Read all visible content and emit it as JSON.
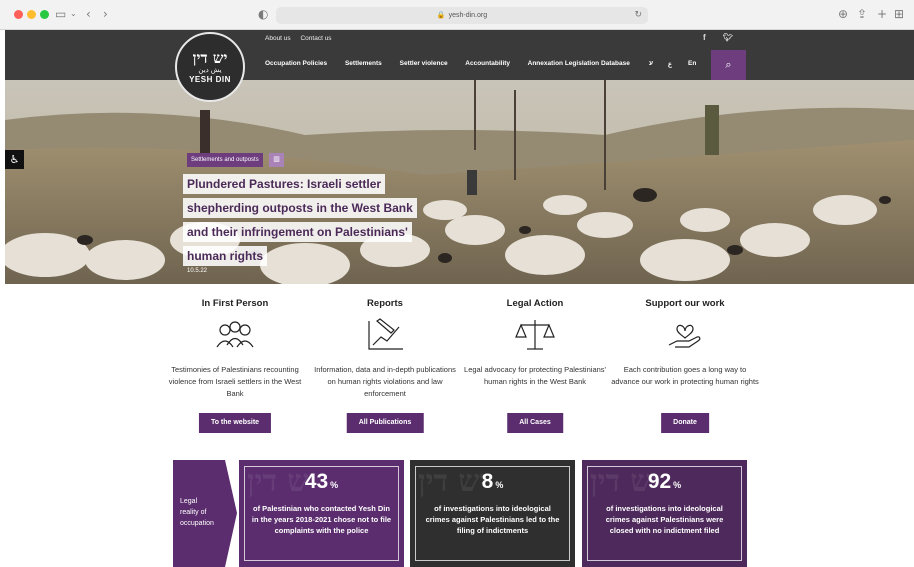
{
  "browser": {
    "url": "yesh-din.org",
    "lock_icon": "lock-icon"
  },
  "site": {
    "logo": {
      "hebrew": "יש דין",
      "arabic": "يش دين",
      "english": "YESH DIN"
    },
    "util_links": [
      "About us",
      "Contact us"
    ],
    "social": [
      "f",
      "t"
    ],
    "nav": [
      "Occupation Policies",
      "Settlements",
      "Settler violence",
      "Accountability",
      "Annexation Legislation Database"
    ],
    "languages": [
      "ע",
      "ع",
      "En"
    ],
    "accent": "#6d3d7e"
  },
  "hero": {
    "tag": "Settlements and outposts",
    "title_lines": [
      "Plundered Pastures: Israeli settler",
      "shepherding outposts in the West Bank",
      "and their infringement on Palestinians'",
      "human rights"
    ],
    "date": "10.5.22"
  },
  "columns": [
    {
      "title": "In First Person",
      "text": "Testimonies of Palestinians recounting violence from Israeli settlers in the West Bank",
      "button": "To the website",
      "icon": "people-icon"
    },
    {
      "title": "Reports",
      "text": "Information, data and in-depth publications on human rights violations and law enforcement",
      "button": "All Publications",
      "icon": "chart-pencil-icon"
    },
    {
      "title": "Legal Action",
      "text": "Legal advocacy for protecting Palestinians' human rights in the West Bank",
      "button": "All Cases",
      "icon": "scales-icon"
    },
    {
      "title": "Support our work",
      "text": "Each contribution goes a long way to advance our work in protecting human rights",
      "button": "Donate",
      "icon": "heart-hand-icon"
    }
  ],
  "legal_label": [
    "Legal",
    "reality of",
    "occupation"
  ],
  "stats": [
    {
      "value": "43",
      "unit": "%",
      "text": "of Palestinian who contacted Yesh Din in the years 2018-2021 chose not to file complaints with the police",
      "color": "#5b2d6e"
    },
    {
      "value": "8",
      "unit": "%",
      "text": "of investigations into ideological crimes against Palestinians led to the filing of indictments",
      "color": "#2f2f2f"
    },
    {
      "value": "92",
      "unit": "%",
      "text": "of investigations into ideological crimes against Palestinians were closed with no indictment filed",
      "color": "#4e2a5c"
    }
  ]
}
